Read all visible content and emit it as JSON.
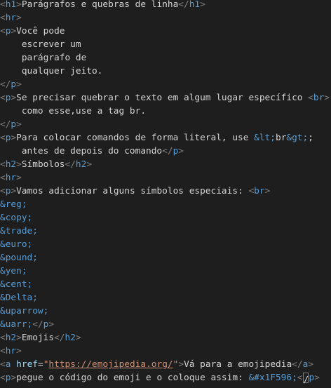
{
  "editor": {
    "colors": {
      "background": "#1e1e1e",
      "bracket": "#808080",
      "tag": "#569cd6",
      "text": "#d4d4d4",
      "entity": "#569cd6",
      "attribute": "#9cdcfe",
      "string": "#ce9178"
    },
    "lines": [
      [
        {
          "t": "b",
          "v": "<"
        },
        {
          "t": "tag",
          "v": "h1"
        },
        {
          "t": "b",
          "v": ">"
        },
        {
          "t": "text",
          "v": "Parágrafos e quebras de linha"
        },
        {
          "t": "b",
          "v": "</"
        },
        {
          "t": "tag",
          "v": "h1"
        },
        {
          "t": "b",
          "v": ">"
        }
      ],
      [
        {
          "t": "b",
          "v": "<"
        },
        {
          "t": "tag",
          "v": "hr"
        },
        {
          "t": "b",
          "v": ">"
        }
      ],
      [
        {
          "t": "b",
          "v": "<"
        },
        {
          "t": "tag",
          "v": "p"
        },
        {
          "t": "b",
          "v": ">"
        },
        {
          "t": "text",
          "v": "Você pode"
        }
      ],
      [
        {
          "t": "text",
          "v": "    escrever um"
        }
      ],
      [
        {
          "t": "text",
          "v": "    parágrafo de"
        }
      ],
      [
        {
          "t": "text",
          "v": "    qualquer jeito."
        }
      ],
      [
        {
          "t": "b",
          "v": "</"
        },
        {
          "t": "tag",
          "v": "p"
        },
        {
          "t": "b",
          "v": ">"
        }
      ],
      [
        {
          "t": "b",
          "v": "<"
        },
        {
          "t": "tag",
          "v": "p"
        },
        {
          "t": "b",
          "v": ">"
        },
        {
          "t": "text",
          "v": "Se precisar quebrar o texto em algum lugar específico "
        },
        {
          "t": "b",
          "v": "<"
        },
        {
          "t": "tag",
          "v": "br"
        },
        {
          "t": "b",
          "v": ">"
        }
      ],
      [
        {
          "t": "text",
          "v": "    como esse,use a tag br."
        }
      ],
      [
        {
          "t": "b",
          "v": "</"
        },
        {
          "t": "tag",
          "v": "p"
        },
        {
          "t": "b",
          "v": ">"
        }
      ],
      [
        {
          "t": "b",
          "v": "<"
        },
        {
          "t": "tag",
          "v": "p"
        },
        {
          "t": "b",
          "v": ">"
        },
        {
          "t": "text",
          "v": "Para colocar comandos de forma literal, use "
        },
        {
          "t": "ent",
          "v": "&lt;"
        },
        {
          "t": "text",
          "v": "br"
        },
        {
          "t": "ent",
          "v": "&gt;"
        },
        {
          "t": "text",
          "v": ";"
        }
      ],
      [
        {
          "t": "text",
          "v": "    antes de depois do comando"
        },
        {
          "t": "b",
          "v": "</"
        },
        {
          "t": "tag",
          "v": "p"
        },
        {
          "t": "b",
          "v": ">"
        }
      ],
      [
        {
          "t": "b",
          "v": "<"
        },
        {
          "t": "tag",
          "v": "h2"
        },
        {
          "t": "b",
          "v": ">"
        },
        {
          "t": "text",
          "v": "Símbolos"
        },
        {
          "t": "b",
          "v": "</"
        },
        {
          "t": "tag",
          "v": "h2"
        },
        {
          "t": "b",
          "v": ">"
        }
      ],
      [
        {
          "t": "b",
          "v": "<"
        },
        {
          "t": "tag",
          "v": "hr"
        },
        {
          "t": "b",
          "v": ">"
        }
      ],
      [
        {
          "t": "b",
          "v": "<"
        },
        {
          "t": "tag",
          "v": "p"
        },
        {
          "t": "b",
          "v": ">"
        },
        {
          "t": "text",
          "v": "Vamos adicionar alguns símbolos especiais: "
        },
        {
          "t": "b",
          "v": "<"
        },
        {
          "t": "tag",
          "v": "br"
        },
        {
          "t": "b",
          "v": ">"
        }
      ],
      [
        {
          "t": "ent",
          "v": "&reg;"
        }
      ],
      [
        {
          "t": "ent",
          "v": "&copy;"
        }
      ],
      [
        {
          "t": "ent",
          "v": "&trade;"
        }
      ],
      [
        {
          "t": "ent",
          "v": "&euro;"
        }
      ],
      [
        {
          "t": "ent",
          "v": "&pound;"
        }
      ],
      [
        {
          "t": "ent",
          "v": "&yen;"
        }
      ],
      [
        {
          "t": "ent",
          "v": "&cent;"
        }
      ],
      [
        {
          "t": "ent",
          "v": "&Delta;"
        }
      ],
      [
        {
          "t": "ent",
          "v": "&uparrow;"
        }
      ],
      [
        {
          "t": "ent",
          "v": "&uarr;"
        },
        {
          "t": "b",
          "v": "</"
        },
        {
          "t": "tag",
          "v": "p"
        },
        {
          "t": "b",
          "v": ">"
        }
      ],
      [
        {
          "t": "b",
          "v": "<"
        },
        {
          "t": "tag",
          "v": "h2"
        },
        {
          "t": "b",
          "v": ">"
        },
        {
          "t": "text",
          "v": "Emojis"
        },
        {
          "t": "b",
          "v": "</"
        },
        {
          "t": "tag",
          "v": "h2"
        },
        {
          "t": "b",
          "v": ">"
        }
      ],
      [
        {
          "t": "b",
          "v": "<"
        },
        {
          "t": "tag",
          "v": "hr"
        },
        {
          "t": "b",
          "v": ">"
        }
      ],
      [
        {
          "t": "b",
          "v": "<"
        },
        {
          "t": "tag",
          "v": "a"
        },
        {
          "t": "text",
          "v": " "
        },
        {
          "t": "attr",
          "v": "href"
        },
        {
          "t": "eq",
          "v": "="
        },
        {
          "t": "str",
          "v": "\""
        },
        {
          "t": "url",
          "v": "https://emojipedia.org/"
        },
        {
          "t": "str",
          "v": "\""
        },
        {
          "t": "b",
          "v": ">"
        },
        {
          "t": "text",
          "v": "Vá para a emojipedia"
        },
        {
          "t": "b",
          "v": "</"
        },
        {
          "t": "tag",
          "v": "a"
        },
        {
          "t": "b",
          "v": ">"
        }
      ],
      [
        {
          "t": "b",
          "v": "<"
        },
        {
          "t": "tag",
          "v": "p"
        },
        {
          "t": "b",
          "v": ">"
        },
        {
          "t": "text",
          "v": "pegue o código do emoji e o coloque assim: "
        },
        {
          "t": "ent",
          "v": "&#x1F596;"
        },
        {
          "t": "b",
          "v": "<"
        },
        {
          "t": "cursor",
          "v": "/"
        },
        {
          "t": "tag",
          "v": "p"
        },
        {
          "t": "b",
          "v": ">"
        }
      ]
    ]
  }
}
